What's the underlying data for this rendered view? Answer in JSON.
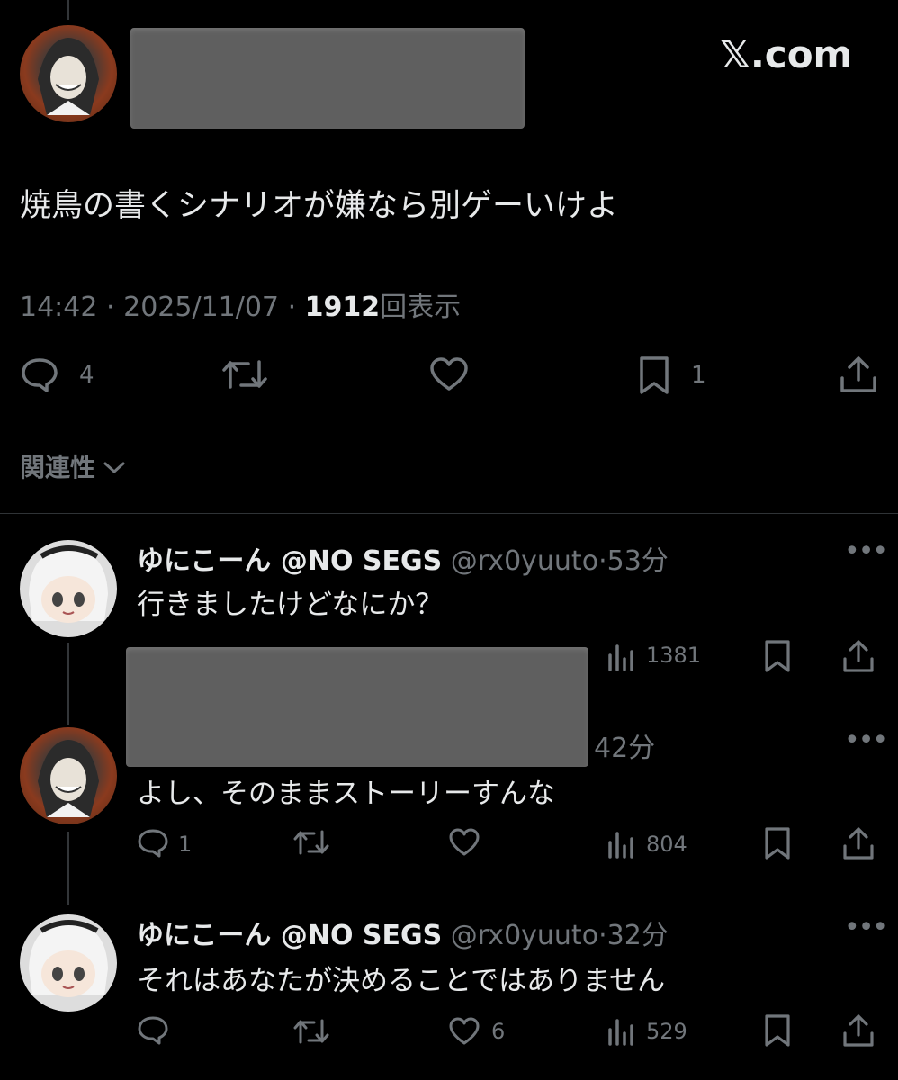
{
  "header": {
    "brand": "𝕏.com"
  },
  "main_post": {
    "text": "焼鳥の書くシナリオが嫌なら別ゲーいけよ",
    "time": "14:42",
    "date": "2025/11/07",
    "views_count": "1912",
    "views_label": "回表示",
    "separator": "·",
    "replies": "4",
    "bookmarks": "1"
  },
  "sort": {
    "label": "関連性"
  },
  "replies": [
    {
      "name": "ゆにこーん @NO SEGS",
      "handle": "@rx0yuuto",
      "time": "53分",
      "text": "行きましたけどなにか？",
      "views": "1381"
    },
    {
      "time": "42分",
      "text": "よし、そのままストーリーすんな",
      "replies": "1",
      "views": "804"
    },
    {
      "name": "ゆにこーん @NO SEGS",
      "handle": "@rx0yuuto",
      "time": "32分",
      "text": "それはあなたが決めることではありません",
      "likes": "6",
      "views": "529"
    }
  ],
  "icons": [
    "reply-icon",
    "repost-icon",
    "like-icon",
    "bookmark-icon",
    "share-icon",
    "views-icon",
    "more-icon",
    "chevron-down-icon"
  ],
  "colors": {
    "background": "#000000",
    "text": "#e7e9ea",
    "muted": "#71767b",
    "redaction": "#5f5f5f"
  }
}
